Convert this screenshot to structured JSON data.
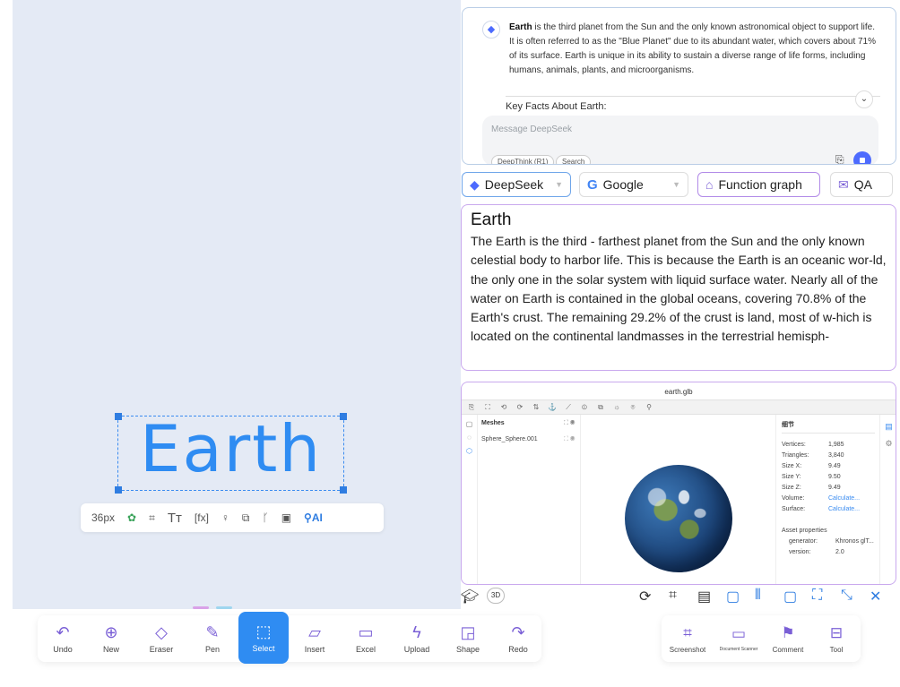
{
  "canvas": {
    "selected_text": "Earth"
  },
  "text_toolbar": {
    "font_size": "36px",
    "palette_icon": "palette-icon",
    "ai_label": "AI"
  },
  "chat": {
    "message_bold": "Earth",
    "message_rest": " is the third planet from the Sun and the only known astronomical object to support life. It is often referred to as the \"Blue Planet\" due to its abundant water, which covers about 71% of its surface. Earth is unique in its ability to sustain a diverse range of life forms, including humans, animals, plants, and microorganisms.",
    "key_facts": "Key Facts About Earth:",
    "input_placeholder": "Message DeepSeek",
    "chip_deepthink": "DeepThink (R1)",
    "chip_search": "Search"
  },
  "tabs": {
    "deepseek": "DeepSeek",
    "google": "Google",
    "function_graph": "Function graph",
    "qa": "QA"
  },
  "text_panel": {
    "title": "Earth",
    "body": "The Earth is the third - farthest planet from the Sun and the only known celestial body to harbor life. This is because the Earth is an oceanic wor-ld, the only one in the solar system with liquid surface water. Nearly all of the water on Earth is contained in the global oceans, covering 70.8% of the Earth's crust. The remaining 29.2% of the crust is land, most of w-hich is located on the continental landmasses in the terrestrial hemisph-"
  },
  "viewer": {
    "title": "earth.glb",
    "meshes_header": "Meshes",
    "mesh_name": "Sphere_Sphere.001",
    "details_title": "细节",
    "details": [
      {
        "k": "Vertices:",
        "v": "1,985"
      },
      {
        "k": "Triangles:",
        "v": "3,840"
      },
      {
        "k": "Size X:",
        "v": "9.49"
      },
      {
        "k": "Size Y:",
        "v": "9.50"
      },
      {
        "k": "Size Z:",
        "v": "9.49"
      },
      {
        "k": "Volume:",
        "v": "Calculate..."
      },
      {
        "k": "Surface:",
        "v": "Calculate..."
      }
    ],
    "asset_props_title": "Asset properties",
    "asset_props": [
      {
        "k": "generator:",
        "v": "Khronos glT..."
      },
      {
        "k": "version:",
        "v": "2.0"
      }
    ],
    "badge_3d": "3D"
  },
  "main_toolbar": {
    "undo": "Undo",
    "new": "New",
    "eraser": "Eraser",
    "pen": "Pen",
    "select": "Select",
    "insert": "Insert",
    "excel": "Excel",
    "upload": "Upload",
    "shape": "Shape",
    "redo": "Redo"
  },
  "side_toolbar": {
    "screenshot": "Screenshot",
    "document_scanner": "Document Scanner",
    "comment": "Comment",
    "tool": "Tool"
  },
  "colors": {
    "accent": "#2f8cf2",
    "purple": "#7a5fd6",
    "deepseek": "#4d6bfe"
  }
}
